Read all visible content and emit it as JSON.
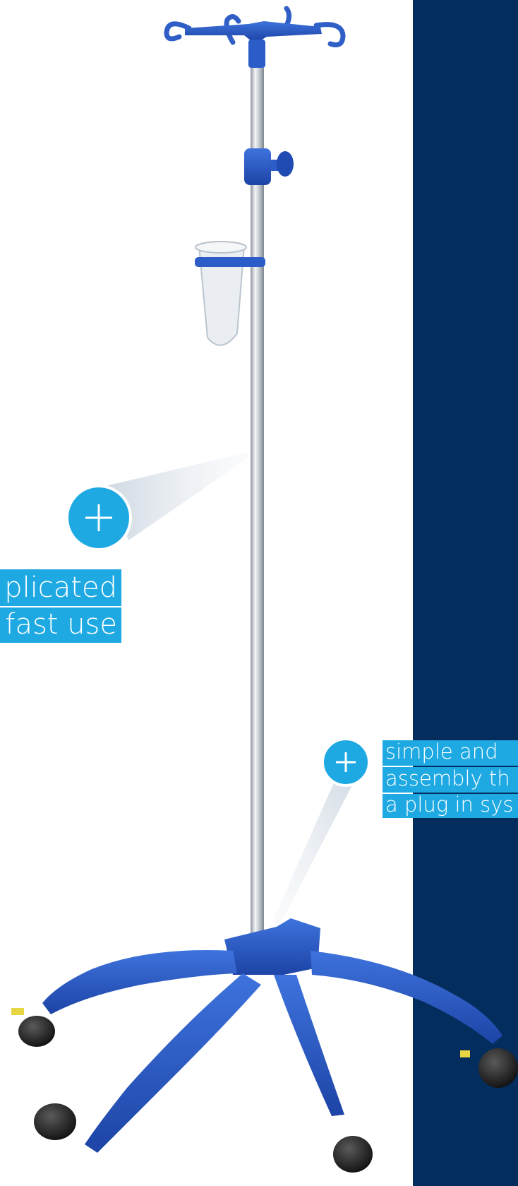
{
  "callouts": [
    {
      "lines": [
        "plicated",
        "fast use"
      ]
    },
    {
      "lines": [
        "simple and",
        "assembly th",
        "a plug in sys"
      ]
    }
  ],
  "colors": {
    "panel": "#032d5d",
    "accent": "#1ea9e3",
    "product_blue": "#2f5fc6",
    "pole": "#c7ccd2"
  },
  "icons": [
    "plus-icon",
    "plus-icon"
  ]
}
